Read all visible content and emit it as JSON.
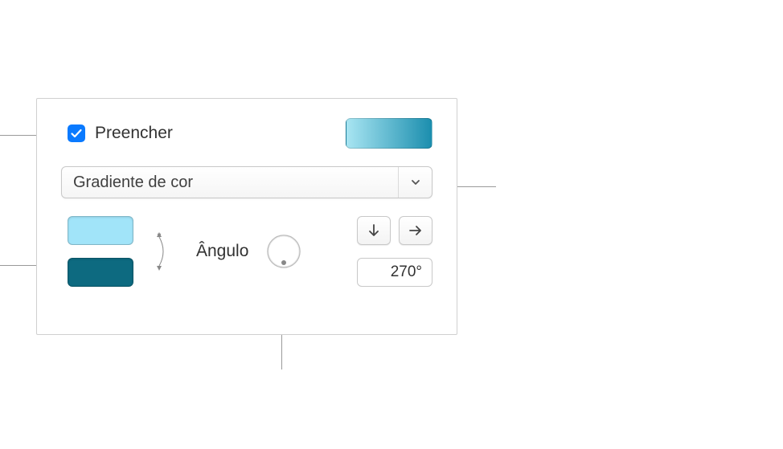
{
  "fill": {
    "checkbox_checked": true,
    "label": "Preencher"
  },
  "preview": {
    "gradient_start": "#a8e5f2",
    "gradient_end": "#1b8eae"
  },
  "dropdown": {
    "selected": "Gradiente de cor"
  },
  "gradient_stops": {
    "color1": "#a1e4f9",
    "color2": "#0d6a80"
  },
  "angle": {
    "label": "Ângulo",
    "value": "270°",
    "dial_degrees": 270
  },
  "icons": {
    "check": "check",
    "chevron_down": "chevron-down",
    "swap": "swap-vertical",
    "arrow_down": "arrow-down",
    "arrow_right": "arrow-right"
  }
}
